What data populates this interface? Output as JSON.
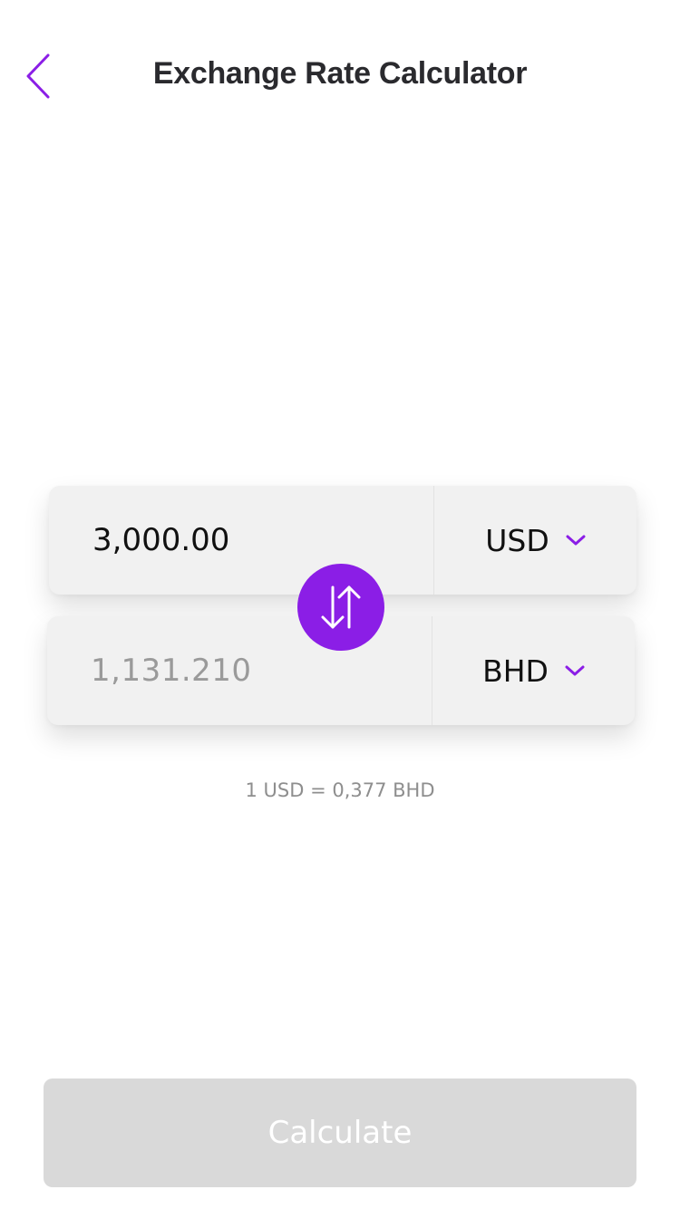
{
  "header": {
    "title": "Exchange Rate Calculator",
    "back_icon": "chevron-left-icon"
  },
  "converter": {
    "from": {
      "amount": "3,000.00",
      "currency": "USD"
    },
    "to": {
      "amount": "1,131.210",
      "currency": "BHD"
    },
    "swap_icon": "swap-vertical-arrows-icon",
    "rate_text": "1 USD = 0,377 BHD"
  },
  "actions": {
    "calculate_label": "Calculate",
    "calculate_enabled": false
  },
  "colors": {
    "accent": "#8b1ee6",
    "card_bg": "#f1f1f1",
    "disabled_button": "#d9d9d9",
    "muted_text": "#8e8e8e"
  }
}
